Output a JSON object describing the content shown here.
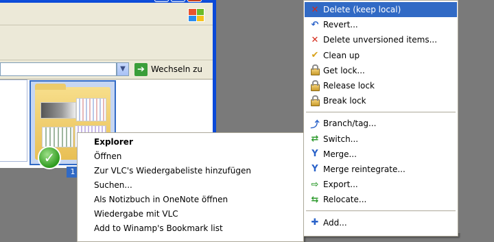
{
  "address_bar": {
    "go_label": "Wechseln zu"
  },
  "selected_file_label": "1",
  "shell_menu": {
    "items": [
      {
        "label": "Explorer",
        "bold": true
      },
      {
        "label": "Öffnen"
      },
      {
        "label": "Zur VLC's Wiedergabeliste hinzufügen"
      },
      {
        "label": "Suchen..."
      },
      {
        "label": "Als Notizbuch in OneNote öffnen"
      },
      {
        "label": "Wiedergabe mit VLC"
      },
      {
        "label": "Add to Winamp's Bookmark list"
      }
    ]
  },
  "svn_menu": {
    "items": [
      {
        "label": "Delete (keep local)",
        "icon": "delete-icon",
        "highlighted": true
      },
      {
        "label": "Revert...",
        "icon": "revert-icon"
      },
      {
        "label": "Delete unversioned items...",
        "icon": "delete-icon"
      },
      {
        "label": "Clean up",
        "icon": "cleanup-icon"
      },
      {
        "label": "Get lock...",
        "icon": "lock-icon"
      },
      {
        "label": "Release lock",
        "icon": "lock-icon"
      },
      {
        "label": "Break lock",
        "icon": "lock-icon"
      },
      {
        "label": "Branch/tag...",
        "icon": "branch-icon"
      },
      {
        "label": "Switch...",
        "icon": "switch-icon"
      },
      {
        "label": "Merge...",
        "icon": "merge-icon"
      },
      {
        "label": "Merge reintegrate...",
        "icon": "merge-icon"
      },
      {
        "label": "Export...",
        "icon": "export-icon"
      },
      {
        "label": "Relocate...",
        "icon": "relocate-icon"
      },
      {
        "label": "Add...",
        "icon": "add-icon"
      }
    ],
    "highlight_color": "#316ac5"
  }
}
